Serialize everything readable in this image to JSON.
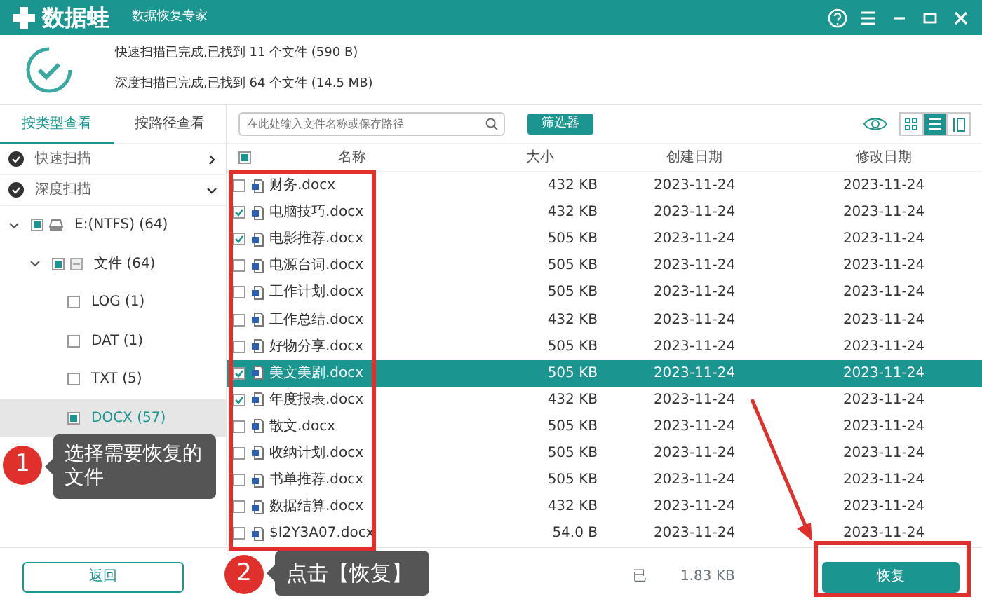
{
  "title_bar": {
    "app_name": "数据蛙",
    "subtitle": "数据恢复专家"
  },
  "scan_summary": [
    "快速扫描已完成,已找到 11 个文件 (590  B)",
    "深度扫描已完成,已找到 64 个文件 (14.5 MB)"
  ],
  "view_tabs": [
    {
      "label": "按类型查看",
      "selected": true
    },
    {
      "label": "按路径查看",
      "selected": false
    }
  ],
  "search": {
    "placeholder": "在此处输入文件名称或保存路径"
  },
  "filter_button": "筛选器",
  "view_modes": [
    {
      "kind": "grid",
      "selected": false
    },
    {
      "kind": "list",
      "selected": true
    },
    {
      "kind": "preview",
      "selected": false
    }
  ],
  "scans": [
    {
      "label": "快速扫描",
      "expanded": false
    },
    {
      "label": "深度扫描",
      "expanded": true
    }
  ],
  "tree": [
    {
      "label": "E:(NTFS) (64)",
      "kind": "drive",
      "checked": false,
      "indeterminate": true,
      "expanded": true,
      "selected": false,
      "children": [
        {
          "label": "文件 (64)",
          "kind": "folder",
          "checked": false,
          "indeterminate": true,
          "expanded": true,
          "selected": false,
          "children": [
            {
              "label": "LOG (1)",
              "checked": false,
              "indeterminate": false,
              "selected": false
            },
            {
              "label": "DAT (1)",
              "checked": false,
              "indeterminate": false,
              "selected": false
            },
            {
              "label": "TXT (5)",
              "checked": false,
              "indeterminate": false,
              "selected": false
            },
            {
              "label": "DOCX (57)",
              "checked": false,
              "indeterminate": true,
              "selected": true
            }
          ]
        }
      ]
    }
  ],
  "table": {
    "header_checked": false,
    "header_indeterminate": true,
    "columns": [
      "名称",
      "大小",
      "创建日期",
      "修改日期"
    ],
    "rows": [
      {
        "name": "财务.docx",
        "size": "432 KB",
        "created": "2023-11-24",
        "modified": "2023-11-24",
        "checked": false,
        "selected": false
      },
      {
        "name": "电脑技巧.docx",
        "size": "432 KB",
        "created": "2023-11-24",
        "modified": "2023-11-24",
        "checked": true,
        "selected": false
      },
      {
        "name": "电影推荐.docx",
        "size": "505 KB",
        "created": "2023-11-24",
        "modified": "2023-11-24",
        "checked": true,
        "selected": false
      },
      {
        "name": "电源台词.docx",
        "size": "505 KB",
        "created": "2023-11-24",
        "modified": "2023-11-24",
        "checked": false,
        "selected": false
      },
      {
        "name": "工作计划.docx",
        "size": "505 KB",
        "created": "2023-11-24",
        "modified": "2023-11-24",
        "checked": false,
        "selected": false
      },
      {
        "name": "工作总结.docx",
        "size": "432 KB",
        "created": "2023-11-24",
        "modified": "2023-11-24",
        "checked": false,
        "selected": false
      },
      {
        "name": "好物分享.docx",
        "size": "505 KB",
        "created": "2023-11-24",
        "modified": "2023-11-24",
        "checked": false,
        "selected": false
      },
      {
        "name": "美文美剧.docx",
        "size": "505 KB",
        "created": "2023-11-24",
        "modified": "2023-11-24",
        "checked": true,
        "selected": true
      },
      {
        "name": "年度报表.docx",
        "size": "432 KB",
        "created": "2023-11-24",
        "modified": "2023-11-24",
        "checked": true,
        "selected": false
      },
      {
        "name": "散文.docx",
        "size": "505 KB",
        "created": "2023-11-24",
        "modified": "2023-11-24",
        "checked": false,
        "selected": false
      },
      {
        "name": "收纳计划.docx",
        "size": "505 KB",
        "created": "2023-11-24",
        "modified": "2023-11-24",
        "checked": false,
        "selected": false
      },
      {
        "name": "书单推荐.docx",
        "size": "505 KB",
        "created": "2023-11-24",
        "modified": "2023-11-24",
        "checked": false,
        "selected": false
      },
      {
        "name": "数据结算.docx",
        "size": "432 KB",
        "created": "2023-11-24",
        "modified": "2023-11-24",
        "checked": false,
        "selected": false
      },
      {
        "name": "$I2Y3A07.docx",
        "size": "54.0 B",
        "created": "2023-11-24",
        "modified": "2023-11-24",
        "checked": false,
        "selected": false
      }
    ]
  },
  "status_parts": [
    "已",
    "1.83 KB"
  ],
  "back_button": "返回",
  "recover_button": "恢复",
  "callouts": [
    {
      "number": "1",
      "text": "选择需要恢复的文件"
    },
    {
      "number": "2",
      "text": "点击【恢复】"
    }
  ]
}
